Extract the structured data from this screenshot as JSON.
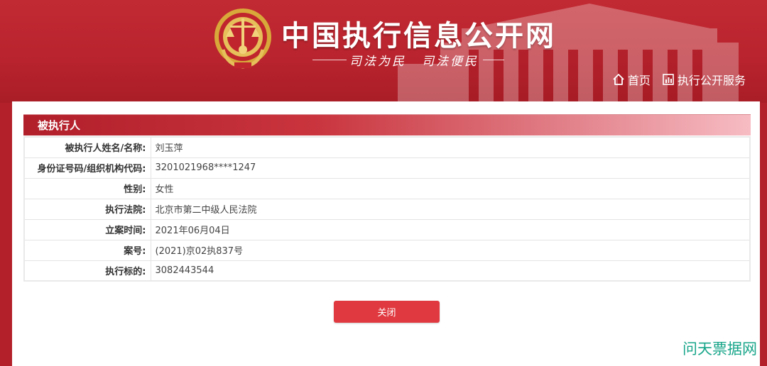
{
  "header": {
    "site_title": "中国执行信息公开网",
    "slogan_left": "司法为民",
    "slogan_right": "司法便民",
    "nav": [
      {
        "label": "首页",
        "icon": "home-icon"
      },
      {
        "label": "执行公开服务",
        "icon": "chart-icon"
      }
    ]
  },
  "section": {
    "title": "被执行人"
  },
  "rows": [
    {
      "label": "被执行人姓名/名称:",
      "value": "刘玉萍"
    },
    {
      "label": "身份证号码/组织机构代码:",
      "value": "3201021968****1247"
    },
    {
      "label": "性别:",
      "value": "女性"
    },
    {
      "label": "执行法院:",
      "value": "北京市第二中级人民法院"
    },
    {
      "label": "立案时间:",
      "value": "2021年06月04日"
    },
    {
      "label": "案号:",
      "value": "(2021)京02执837号"
    },
    {
      "label": "执行标的:",
      "value": "3082443544"
    }
  ],
  "close_button": {
    "label": "关闭"
  },
  "watermark": "问天票据网",
  "colors": {
    "header_red": "#b8232d",
    "button_red": "#e03a40",
    "watermark_green": "#17a589"
  }
}
